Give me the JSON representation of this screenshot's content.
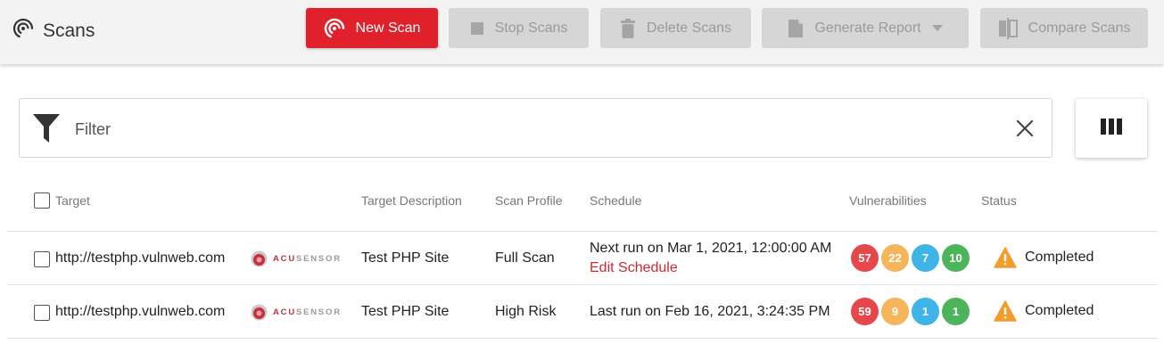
{
  "header": {
    "title": "Scans",
    "icon": "scan-radar-icon",
    "buttons": {
      "new_scan": "New Scan",
      "stop_scans": "Stop Scans",
      "delete_scans": "Delete Scans",
      "generate_report": "Generate Report",
      "compare_scans": "Compare Scans"
    }
  },
  "filter": {
    "placeholder": "Filter"
  },
  "table": {
    "columns": {
      "target": "Target",
      "description": "Target Description",
      "profile": "Scan Profile",
      "schedule": "Schedule",
      "vulnerabilities": "Vulnerabilities",
      "status": "Status"
    },
    "rows": [
      {
        "target": "http://testphp.vulnweb.com",
        "sensor_a": "ACU",
        "sensor_b": "SENSOR",
        "description": "Test PHP Site",
        "profile": "Full Scan",
        "schedule": "Next run on Mar 1, 2021, 12:00:00 AM",
        "schedule_link": "Edit Schedule",
        "vulns": {
          "high": "57",
          "medium": "22",
          "low": "7",
          "info": "10"
        },
        "status": "Completed"
      },
      {
        "target": "http://testphp.vulnweb.com",
        "sensor_a": "ACU",
        "sensor_b": "SENSOR",
        "description": "Test PHP Site",
        "profile": "High Risk",
        "schedule": "Last run on Feb 16, 2021, 3:24:35 PM",
        "vulns": {
          "high": "59",
          "medium": "9",
          "low": "1",
          "info": "1"
        },
        "status": "Completed"
      }
    ]
  },
  "colors": {
    "primary": "#e0212b",
    "vuln_high": "#e5474b",
    "vuln_medium": "#f5b55b",
    "vuln_low": "#3fb4e6",
    "vuln_info": "#4cb45a",
    "warning": "#f39c2b"
  }
}
